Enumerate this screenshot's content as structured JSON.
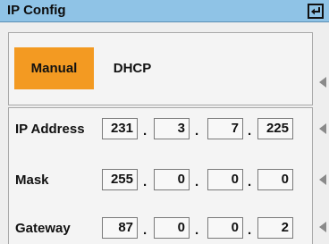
{
  "window": {
    "title": "IP Config"
  },
  "mode": {
    "manual_label": "Manual",
    "dhcp_label": "DHCP",
    "selected": "Manual"
  },
  "fields": {
    "ip": {
      "label": "IP Address",
      "octets": [
        "231",
        "3",
        "7",
        "225"
      ]
    },
    "mask": {
      "label": "Mask",
      "octets": [
        "255",
        "0",
        "0",
        "0"
      ]
    },
    "gateway": {
      "label": "Gateway",
      "octets": [
        "87",
        "0",
        "0",
        "2"
      ]
    }
  },
  "separator": ".",
  "colors": {
    "titlebar": "#8fc3e6",
    "selected_mode": "#f39a22",
    "background": "#eeeeee"
  },
  "icons": {
    "enter": "enter-icon",
    "side_arrow": "chevron-left-icon"
  }
}
